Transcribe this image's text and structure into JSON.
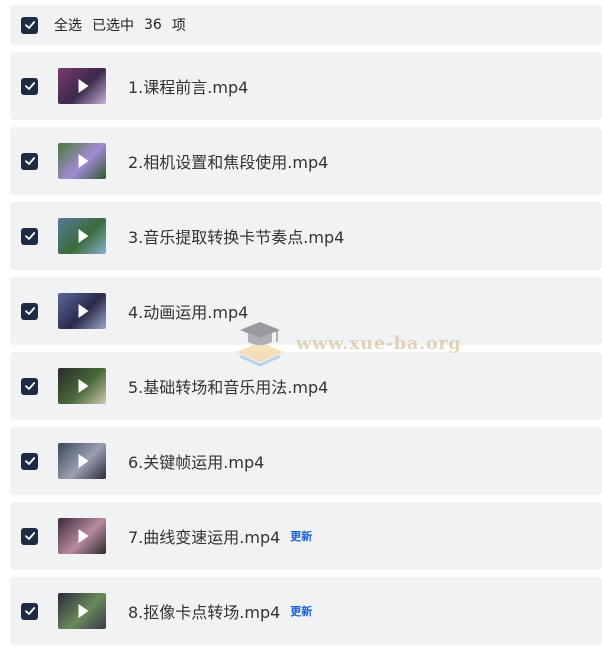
{
  "select_all": {
    "label": "全选",
    "selected_prefix": "已选中",
    "count": "36",
    "suffix": "项"
  },
  "files": [
    {
      "title": "1.课程前言.mp4",
      "badge": "",
      "thumb_colors": [
        "#7a3a6e",
        "#3b2a4a",
        "#c8b0d8"
      ]
    },
    {
      "title": "2.相机设置和焦段使用.mp4",
      "badge": "",
      "thumb_colors": [
        "#4c7a3a",
        "#a28bd8",
        "#2e5a2a"
      ]
    },
    {
      "title": "3.音乐提取转换卡节奏点.mp4",
      "badge": "",
      "thumb_colors": [
        "#5a7a9a",
        "#3a6a3a",
        "#8ab0d0"
      ]
    },
    {
      "title": "4.动画运用.mp4",
      "badge": "",
      "thumb_colors": [
        "#5a6a9a",
        "#2a2a4a",
        "#9aa8c8"
      ]
    },
    {
      "title": "5.基础转场和音乐用法.mp4",
      "badge": "",
      "thumb_colors": [
        "#2a2a2a",
        "#4a6a3a",
        "#d0c8b0"
      ]
    },
    {
      "title": "6.关键帧运用.mp4",
      "badge": "",
      "thumb_colors": [
        "#3a4a5a",
        "#9aa0b0",
        "#2a2a3a"
      ]
    },
    {
      "title": "7.曲线变速运用.mp4",
      "badge": "更新",
      "thumb_colors": [
        "#3a2a3a",
        "#b88aa0",
        "#2a2a2a"
      ]
    },
    {
      "title": "8.抠像卡点转场.mp4",
      "badge": "更新",
      "thumb_colors": [
        "#2a2a3a",
        "#6a8a5a",
        "#3a3a4a"
      ]
    }
  ],
  "watermark": {
    "text": "www.xue-ba.org"
  },
  "colors": {
    "checkbox": "#1f2a44",
    "row_bg": "#f1f2f4",
    "badge": "#1d62d6"
  }
}
